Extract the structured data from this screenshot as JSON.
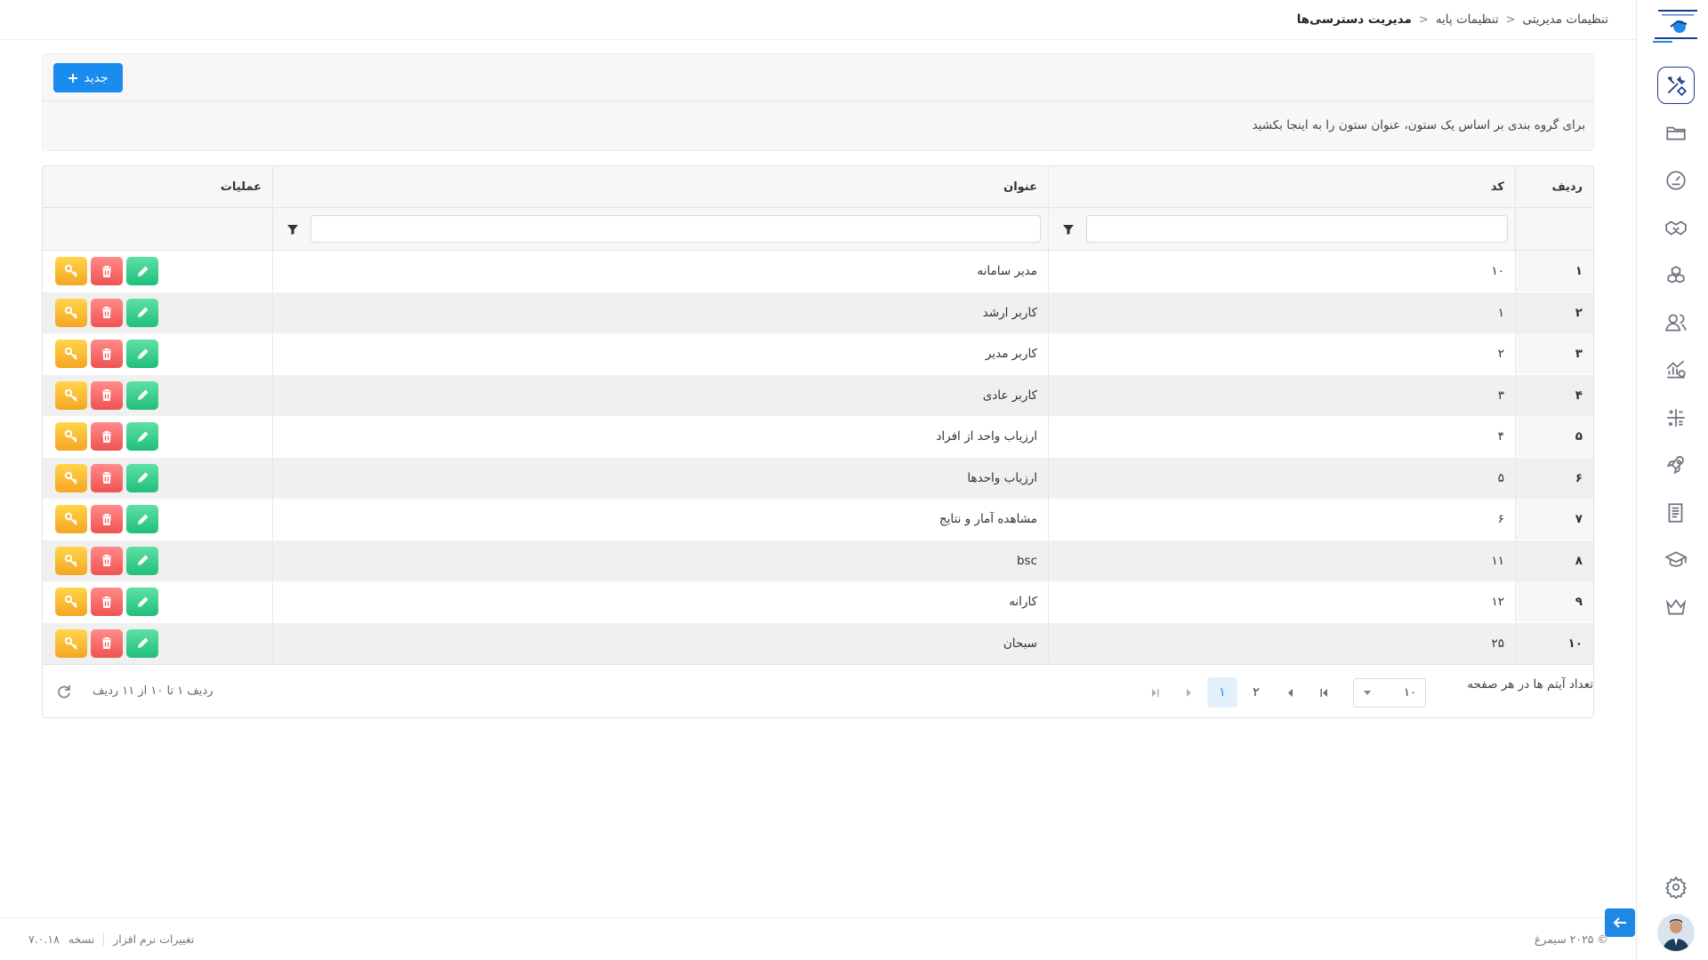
{
  "breadcrumb": {
    "item1": "تنظیمات مدیریتی",
    "item2": "تنظیمات پایه",
    "current": "مدیریت دسترسی‌ها"
  },
  "toolbar": {
    "new_label": "جدید"
  },
  "group_hint": "برای گروه بندی بر اساس یک ستون، عنوان ستون را به اینجا بکشید",
  "grid": {
    "columns": {
      "index": "ردیف",
      "code": "کد",
      "title": "عنوان",
      "ops": "عملیات"
    },
    "rows": [
      {
        "index": "۱",
        "code": "۱۰",
        "title": "مدیر سامانه"
      },
      {
        "index": "۲",
        "code": "۱",
        "title": "کاربر ارشد"
      },
      {
        "index": "۳",
        "code": "۲",
        "title": "کاربر مدیر"
      },
      {
        "index": "۴",
        "code": "۳",
        "title": "کاربر عادی"
      },
      {
        "index": "۵",
        "code": "۴",
        "title": "ارزیاب واحد از افراد"
      },
      {
        "index": "۶",
        "code": "۵",
        "title": "ارزیاب واحدها"
      },
      {
        "index": "۷",
        "code": "۶",
        "title": "مشاهده آمار و نتایج"
      },
      {
        "index": "۸",
        "code": "۱۱",
        "title": "bsc"
      },
      {
        "index": "۹",
        "code": "۱۲",
        "title": "کارانه"
      },
      {
        "index": "۱۰",
        "code": "۲۵",
        "title": "سبحان"
      }
    ]
  },
  "pager": {
    "pages": [
      "۱",
      "۲"
    ],
    "current_page": "۱",
    "page_size": "۱۰",
    "page_size_label": "تعداد آیتم ها در هر صفحه",
    "range_info": "ردیف ۱ تا ۱۰ از ۱۱ ردیف"
  },
  "footer": {
    "copyright": "© ۲۰۲۵ سیمرغ",
    "changes": "تغییرات نرم افزار",
    "version_label": "نسخه",
    "version": "۷.۰.۱۸"
  },
  "sidebar": {
    "icons": [
      "tools-icon",
      "folder-icon",
      "gauge-icon",
      "handshake-icon",
      "boxes-icon",
      "users-icon",
      "chart-money-icon",
      "calculator-icon",
      "rocket-icon",
      "book-icon",
      "graduation-cap-icon",
      "crown-icon",
      "settings-icon"
    ]
  },
  "colors": {
    "primary": "#1a8cf0",
    "active_nav": "#1e3a8a",
    "edit": "#1fbf7a",
    "delete": "#ef5350",
    "key": "#f5a623"
  }
}
